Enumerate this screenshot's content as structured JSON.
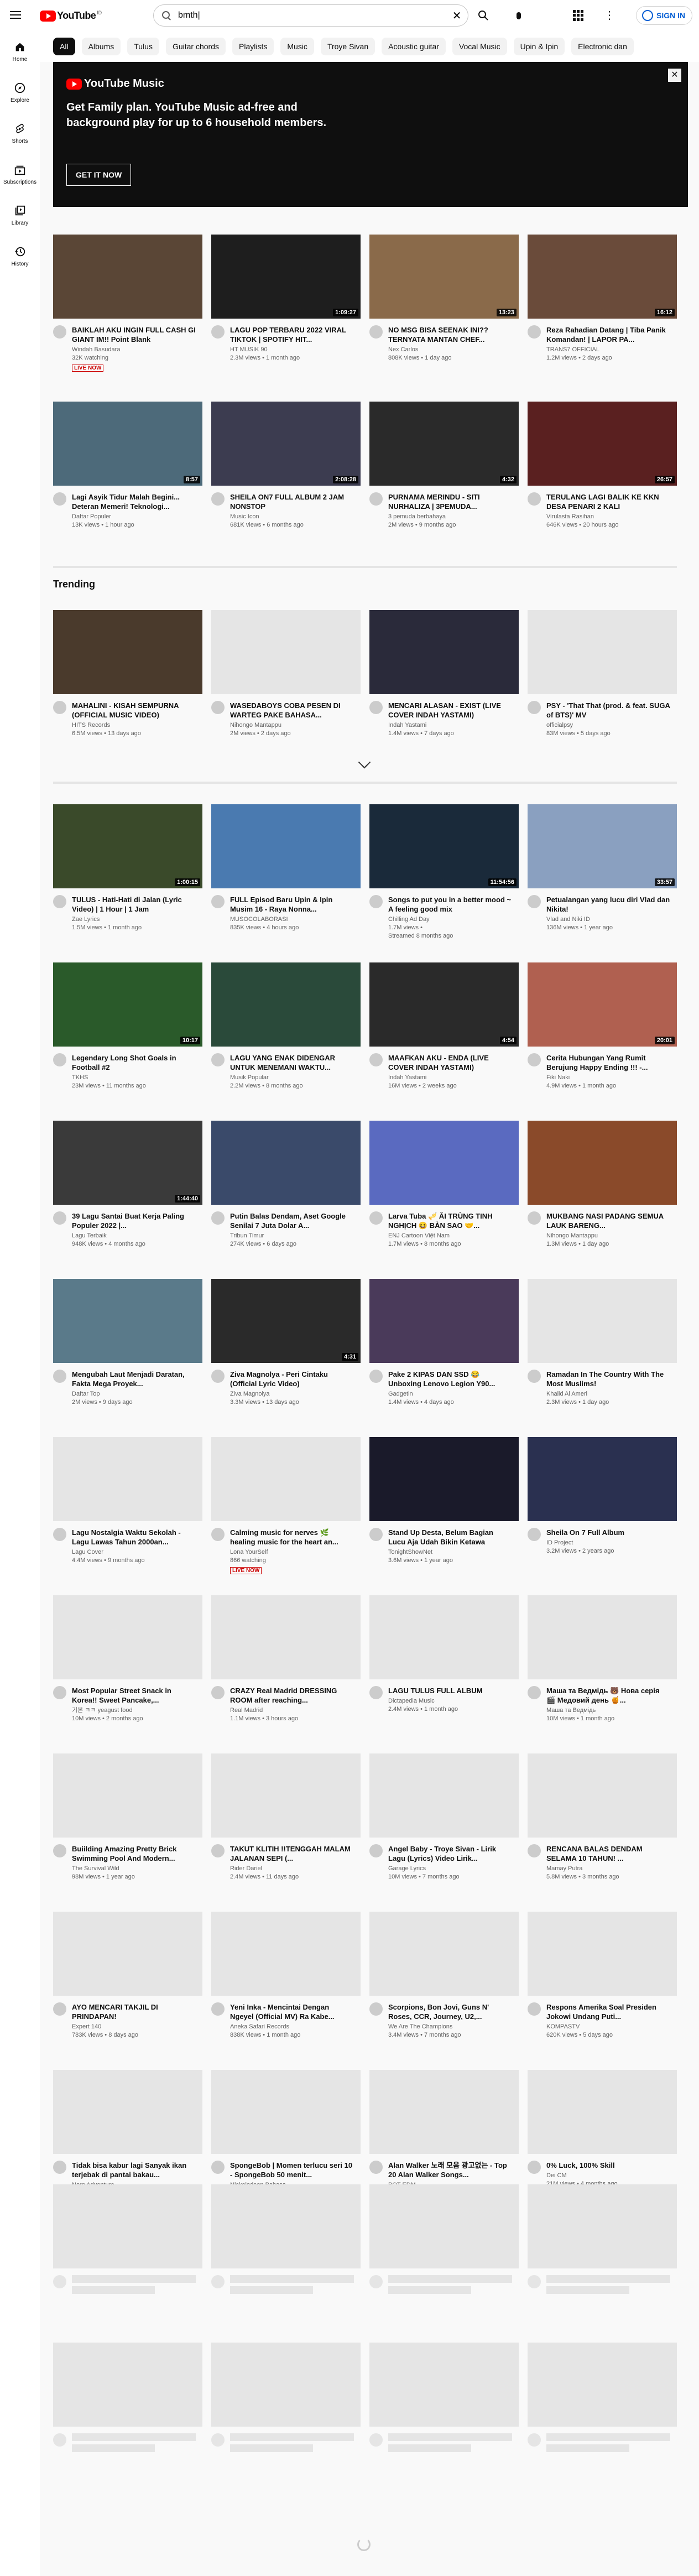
{
  "header": {
    "search_query": "bmth|",
    "signin_label": "SIGN IN",
    "logo_text": "YouTube",
    "logo_region": "ID"
  },
  "guide": [
    {
      "label": "Home",
      "icon": "home-icon"
    },
    {
      "label": "Explore",
      "icon": "compass-icon"
    },
    {
      "label": "Shorts",
      "icon": "shorts-icon"
    },
    {
      "label": "Subscriptions",
      "icon": "subscriptions-icon"
    },
    {
      "label": "Library",
      "icon": "library-icon"
    },
    {
      "label": "History",
      "icon": "history-icon"
    }
  ],
  "chips": [
    "All",
    "Albums",
    "Tulus",
    "Guitar chords",
    "Playlists",
    "Music",
    "Troye Sivan",
    "Acoustic guitar",
    "Vocal Music",
    "Upin & Ipin",
    "Electronic dan"
  ],
  "banner": {
    "logo": "YouTube Music",
    "headline": "Get Family plan. YouTube Music ad-free and background play for up to 6 household members.",
    "cta": "GET IT NOW",
    "close": "✕"
  },
  "trending_title": "Trending",
  "videos": [
    {
      "title": "BAIKLAH AKU INGIN FULL CASH GI GIANT IM!! Point Blank",
      "channel": "Windah Basudara",
      "stats": "32K watching",
      "badge": "LIVE NOW",
      "duration": "",
      "color": "#5a4636"
    },
    {
      "title": "LAGU POP TERBARU 2022 VIRAL TIKTOK | SPOTIFY HIT...",
      "channel": "HT MUSIK 90",
      "stats": "2.3M views • 1 month ago",
      "badge": "",
      "duration": "1:09:27",
      "color": "#1e1e1e"
    },
    {
      "title": "NO MSG BISA SEENAK INI?? TERNYATA MANTAN CHEF...",
      "channel": "Nex Carlos",
      "stats": "808K views • 1 day ago",
      "badge": "",
      "duration": "13:23",
      "color": "#8a6a4a"
    },
    {
      "title": "Reza Rahadian Datang | Tiba Panik Komandan! | LAPOR PA...",
      "channel": "TRANS7 OFFICIAL",
      "stats": "1.2M views • 2 days ago",
      "badge": "",
      "duration": "16:12",
      "color": "#6a4b3a"
    },
    {
      "title": "Lagi Asyik Tidur Malah Begini... Deteran Memeri! Teknologi...",
      "channel": "Daftar Populer",
      "stats": "13K views • 1 hour ago",
      "badge": "",
      "duration": "8:57",
      "color": "#4d6a7a"
    },
    {
      "title": "SHEILA ON7 FULL ALBUM 2 JAM NONSTOP",
      "channel": "Music Icon",
      "stats": "681K views • 6 months ago",
      "badge": "",
      "duration": "2:08:28",
      "color": "#3c3c50"
    },
    {
      "title": "PURNAMA MERINDU - SITI NURHALIZA | 3PEMUDA...",
      "channel": "3 pemuda berbahaya",
      "stats": "2M views • 9 months ago",
      "badge": "",
      "duration": "4:32",
      "color": "#2a2a2a"
    },
    {
      "title": "TERULANG LAGI BALIK KE KKN DESA PENARI 2 KALI",
      "channel": "Virulasta Rasihan",
      "stats": "646K views • 20 hours ago",
      "badge": "",
      "duration": "26:57",
      "color": "#5a2020"
    },
    {
      "title": "MAHALINI - KISAH SEMPURNA (OFFICIAL MUSIC VIDEO)",
      "channel": "HITS Records",
      "stats": "6.5M views • 13 days ago",
      "badge": "",
      "duration": "",
      "color": "#4a3a2c"
    },
    {
      "title": "WASEDABOYS COBA PESEN DI WARTEG PAKE BAHASA...",
      "channel": "Nihongo Mantappu",
      "stats": "2M views • 2 days ago",
      "badge": "",
      "duration": "",
      "color": "#e5e5e5"
    },
    {
      "title": "MENCARI ALASAN - EXIST (LIVE COVER INDAH YASTAMI)",
      "channel": "Indah Yastami",
      "stats": "1.4M views • 7 days ago",
      "badge": "",
      "duration": "",
      "color": "#2a2a3a"
    },
    {
      "title": "PSY - 'That That (prod. & feat. SUGA of BTS)' MV",
      "channel": "officialpsy",
      "stats": "83M views • 5 days ago",
      "badge": "",
      "duration": "",
      "color": "#e5e5e5"
    },
    {
      "title": "TULUS - Hati-Hati di Jalan (Lyric Video) | 1 Hour | 1 Jam",
      "channel": "Zae Lyrics",
      "stats": "1.5M views • 1 month ago",
      "badge": "",
      "duration": "1:00:15",
      "color": "#3a4a2a"
    },
    {
      "title": "FULL Episod Baru Upin & Ipin Musim 16 - Raya Nonna...",
      "channel": "MUSOCOLABORASI",
      "stats": "835K views • 4 hours ago",
      "badge": "",
      "duration": "",
      "color": "#4a7ab0"
    },
    {
      "title": "Songs to put you in a better mood ~ A feeling good mix",
      "channel": "Chilling Ad Day",
      "stats": "1.7M views •",
      "badge": "Streamed 8 months ago",
      "duration": "11:54:56",
      "color": "#1a2a3a"
    },
    {
      "title": "Petualangan yang lucu diri Vlad dan Nikita!",
      "channel": "Vlad and Niki ID",
      "stats": "136M views • 1 year ago",
      "badge": "",
      "duration": "33:57",
      "color": "#8aa0c0"
    },
    {
      "title": "Legendary Long Shot Goals in Football #2",
      "channel": "TKHS",
      "stats": "23M views • 11 months ago",
      "badge": "",
      "duration": "10:17",
      "color": "#2a5a2a"
    },
    {
      "title": "LAGU YANG ENAK DIDENGAR UNTUK MENEMANI WAKTU...",
      "channel": "Musik Popular",
      "stats": "2.2M views • 8 months ago",
      "badge": "",
      "duration": "",
      "color": "#2a4a3a"
    },
    {
      "title": "MAAFKAN AKU - ENDA (LIVE COVER INDAH YASTAMI)",
      "channel": "Indah Yastami",
      "stats": "16M views • 2 weeks ago",
      "badge": "",
      "duration": "4:54",
      "color": "#2a2a2a"
    },
    {
      "title": "Cerita Hubungan Yang Rumit Berujung Happy Ending !!! -...",
      "channel": "Fiki Naki",
      "stats": "4.9M views • 1 month ago",
      "badge": "",
      "duration": "20:01",
      "color": "#b06050"
    },
    {
      "title": "39 Lagu Santai Buat Kerja Paling Populer 2022 |...",
      "channel": "Lagu Terbaik",
      "stats": "948K views • 4 months ago",
      "badge": "",
      "duration": "1:44:40",
      "color": "#3a3a3a"
    },
    {
      "title": "Putin Balas Dendam, Aset Google Senilai 7 Juta Dolar A...",
      "channel": "Tribun Timur",
      "stats": "274K views • 6 days ago",
      "badge": "",
      "duration": "",
      "color": "#3a4a6a"
    },
    {
      "title": "Larva Tuba 🎺 ĂI TRÙNG TINH NGHỊCH 😆 BẢN SAO 🤝...",
      "channel": "ENJ Cartoon Việt Nam",
      "stats": "1.7M views • 8 months ago",
      "badge": "",
      "duration": "",
      "color": "#5a6ac0"
    },
    {
      "title": "MUKBANG NASI PADANG SEMUA LAUK BARENG...",
      "channel": "Nihongo Mantappu",
      "stats": "1.3M views • 1 day ago",
      "badge": "",
      "duration": "",
      "color": "#8a4a2a"
    },
    {
      "title": "Mengubah Laut Menjadi Daratan, Fakta Mega Proyek...",
      "channel": "Daftar Top",
      "stats": "2M views • 9 days ago",
      "badge": "",
      "duration": "",
      "color": "#5a7a8a"
    },
    {
      "title": "Ziva Magnolya - Peri Cintaku (Official Lyric Video)",
      "channel": "Ziva Magnolya",
      "stats": "3.3M views • 13 days ago",
      "badge": "",
      "duration": "4:31",
      "color": "#2a2a2a"
    },
    {
      "title": "Pake 2 KIPAS DAN SSD 😂 Unboxing Lenovo Legion Y90...",
      "channel": "Gadgetin",
      "stats": "1.4M views • 4 days ago",
      "badge": "",
      "duration": "",
      "color": "#4a3a5a"
    },
    {
      "title": "Ramadan In The Country With The Most Muslims!",
      "channel": "Khalid Al Ameri",
      "stats": "2.3M views • 1 day ago",
      "badge": "",
      "duration": "",
      "color": "#e5e5e5"
    },
    {
      "title": "Lagu Nostalgia Waktu Sekolah - Lagu Lawas Tahun 2000an...",
      "channel": "Lagu Cover",
      "stats": "4.4M views • 9 months ago",
      "badge": "",
      "duration": "",
      "color": "#e5e5e5"
    },
    {
      "title": "Calming music for nerves 🌿 healing music for the heart an...",
      "channel": "Lona YourSelf",
      "stats": "866 watching",
      "badge": "LIVE NOW",
      "duration": "",
      "color": "#e5e5e5"
    },
    {
      "title": "Stand Up Desta, Belum Bagian Lucu Aja Udah Bikin Ketawa",
      "channel": "TonightShowNet",
      "stats": "3.6M views • 1 year ago",
      "badge": "",
      "duration": "",
      "color": "#1a1a2a"
    },
    {
      "title": "Sheila On 7 Full Album",
      "channel": "ID Project",
      "stats": "3.2M views • 2 years ago",
      "badge": "",
      "duration": "",
      "color": "#2a3050"
    },
    {
      "title": "Most Popular Street Snack in Korea!! Sweet Pancake,...",
      "channel": "기본 ㅋㅋ yeagust food",
      "stats": "10M views • 2 months ago",
      "badge": "",
      "duration": "",
      "color": "#e5e5e5"
    },
    {
      "title": "CRAZY Real Madrid DRESSING ROOM after reaching...",
      "channel": "Real Madrid",
      "stats": "1.1M views • 3 hours ago",
      "badge": "",
      "duration": "",
      "color": "#e5e5e5"
    },
    {
      "title": "LAGU TULUS FULL ALBUM",
      "channel": "Dictapedia Music",
      "stats": "2.4M views • 1 month ago",
      "badge": "",
      "duration": "",
      "color": "#e5e5e5"
    },
    {
      "title": "Маша та Ведмідь 🐻 Нова серія 🎬 Медовий день 🍯...",
      "channel": "Маша та Ведмідь",
      "stats": "10M views • 1 month ago",
      "badge": "",
      "duration": "",
      "color": "#e5e5e5"
    },
    {
      "title": "Buiilding Amazing Pretty Brick Swimming Pool And Modern...",
      "channel": "The Survival Wild",
      "stats": "98M views • 1 year ago",
      "badge": "",
      "duration": "",
      "color": "#e5e5e5"
    },
    {
      "title": "TAKUT KLITIH !!TENGGAH MALAM JALANAN SEPI (...",
      "channel": "Rider Dariel",
      "stats": "2.4M views • 11 days ago",
      "badge": "",
      "duration": "",
      "color": "#e5e5e5"
    },
    {
      "title": "Angel Baby - Troye Sivan - Lirik Lagu (Lyrics) Video Lirik...",
      "channel": "Garage Lyrics",
      "stats": "10M views • 7 months ago",
      "badge": "",
      "duration": "",
      "color": "#e5e5e5"
    },
    {
      "title": "RENCANA BALAS DENDAM SELAMA 10 TAHUN! ...",
      "channel": "Mamay Putra",
      "stats": "5.8M views • 3 months ago",
      "badge": "",
      "duration": "",
      "color": "#e5e5e5"
    },
    {
      "title": "AYO MENCARI TAKJIL DI PRINDAPAN!",
      "channel": "Expert 140",
      "stats": "783K views • 8 days ago",
      "badge": "",
      "duration": "",
      "color": "#e5e5e5"
    },
    {
      "title": "Yeni Inka - Mencintai Dengan Ngeyel (Official MV) Ra Kabe...",
      "channel": "Aneka Safari Records",
      "stats": "838K views • 1 month ago",
      "badge": "",
      "duration": "",
      "color": "#e5e5e5"
    },
    {
      "title": "Scorpions, Bon Jovi, Guns N' Roses, CCR, Journey, U2,...",
      "channel": "We Are The Champions",
      "stats": "3.4M views • 7 months ago",
      "badge": "",
      "duration": "",
      "color": "#e5e5e5"
    },
    {
      "title": "Respons Amerika Soal Presiden Jokowi Undang Puti...",
      "channel": "KOMPASTV",
      "stats": "620K views • 5 days ago",
      "badge": "",
      "duration": "",
      "color": "#e5e5e5"
    },
    {
      "title": "Tidak bisa kabur lagi Sanyak ikan terjebak di pantai bakau...",
      "channel": "Norn Adventure",
      "stats": "847K views • 1 month ago",
      "badge": "",
      "duration": "",
      "color": "#e5e5e5"
    },
    {
      "title": "SpongeBob | Momen terlucu seri 10 - SpongeBob 50 menit...",
      "channel": "Nickelodeon Bahasa",
      "stats": "1.4M views • 7 days ago",
      "badge": "",
      "duration": "",
      "color": "#e5e5e5"
    },
    {
      "title": "Alan Walker 노래 모음 광고없는 - Top 20 Alan Walker Songs...",
      "channel": "BOT EDM",
      "stats": "13M views • 1 year ago",
      "badge": "",
      "duration": "",
      "color": "#e5e5e5"
    },
    {
      "title": "0% Luck, 100% Skill",
      "channel": "Dei CM",
      "stats": "21M views • 4 months ago",
      "badge": "",
      "duration": "",
      "color": "#e5e5e5"
    }
  ]
}
